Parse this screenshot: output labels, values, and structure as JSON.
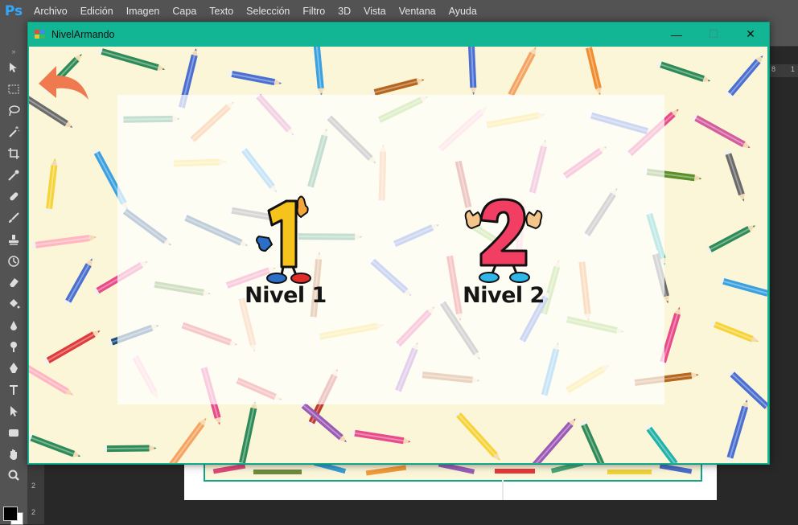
{
  "photoshop": {
    "logo": "Ps",
    "menu": [
      "Archivo",
      "Edición",
      "Imagen",
      "Capa",
      "Texto",
      "Selección",
      "Filtro",
      "3D",
      "Vista",
      "Ventana",
      "Ayuda"
    ],
    "ruler_v_numbers": [
      "1",
      "2",
      "2",
      "2"
    ],
    "ruler_h_numbers": [
      "8",
      "1"
    ],
    "tools": [
      "move-tool",
      "marquee-tool",
      "lasso-tool",
      "magic-wand-tool",
      "crop-tool",
      "eyedropper-tool",
      "healing-brush-tool",
      "brush-tool",
      "clone-stamp-tool",
      "history-brush-tool",
      "eraser-tool",
      "paint-bucket-tool",
      "blur-tool",
      "dodge-tool",
      "pen-tool",
      "type-tool",
      "path-selection-tool",
      "shape-tool",
      "hand-tool",
      "zoom-tool"
    ]
  },
  "window": {
    "title": "NivelArmando",
    "minimize_glyph": "—",
    "maximize_glyph": "☐",
    "close_glyph": "✕"
  },
  "levels": [
    {
      "label": "Nivel 1",
      "number": "1",
      "color": "#f6c21c"
    },
    {
      "label": "Nivel 2",
      "number": "2",
      "color": "#f23e62"
    }
  ],
  "colors": {
    "window_accent": "#12b594",
    "background": "#fbf6d7",
    "back_arrow": "#f07a50"
  },
  "icons": {
    "back": "back-arrow-icon"
  }
}
